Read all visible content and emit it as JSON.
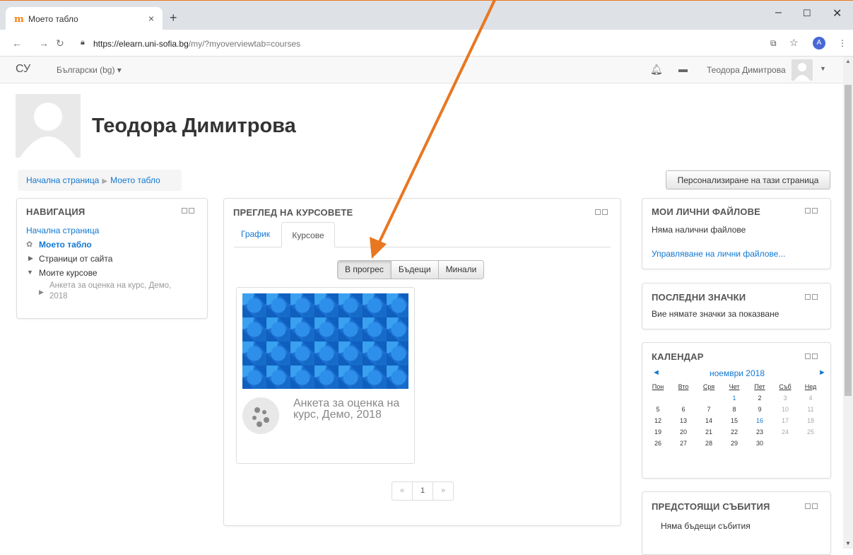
{
  "browser": {
    "tab_title": "Моето табло",
    "tab_close": "×",
    "new_tab": "+",
    "url_host": "https://elearn.uni-sofia.bg",
    "url_path": "/my/?myoverviewtab=courses",
    "profile_letter": "A",
    "win_min": "–",
    "win_max": "☐",
    "win_close": "✕"
  },
  "navbar": {
    "brand": "СУ",
    "language": "Български (bg) ▾",
    "user_name": "Теодора Димитрова"
  },
  "header": {
    "title": "Теодора Димитрова",
    "breadcrumb": [
      "Начална страница",
      "Моето табло"
    ],
    "customize_button": "Персонализиране на тази страница"
  },
  "navigation_block": {
    "title": "НАВИГАЦИЯ",
    "home": "Начална страница",
    "dashboard": "Моето табло",
    "site_pages": "Страници от сайта",
    "my_courses": "Моите курсове",
    "course_line1": "Анкета за оценка на курс, Демо,",
    "course_line2": "2018"
  },
  "course_overview": {
    "title": "ПРЕГЛЕД НА КУРСОВЕТЕ",
    "tabs": [
      "График",
      "Курсове"
    ],
    "filters": [
      "В прогрес",
      "Бъдещи",
      "Минали"
    ],
    "course_name": "Анкета за оценка на курс, Демо, 2018",
    "pager": [
      "«",
      "1",
      "»"
    ]
  },
  "private_files": {
    "title": "МОИ ЛИЧНИ ФАЙЛОВЕ",
    "empty": "Няма налични файлове",
    "manage": "Управляване на лични файлове..."
  },
  "badges": {
    "title": "ПОСЛЕДНИ ЗНАЧКИ",
    "empty": "Вие нямате значки за показване"
  },
  "calendar": {
    "title": "КАЛЕНДАР",
    "prev": "◄",
    "month": "ноември 2018",
    "next": "►",
    "weekdays": [
      "Пон",
      "Вто",
      "Сря",
      "Чет",
      "Пет",
      "Съб",
      "Нед"
    ],
    "weeks": [
      [
        "",
        "",
        "",
        "1",
        "2",
        "3",
        "4"
      ],
      [
        "5",
        "6",
        "7",
        "8",
        "9",
        "10",
        "11"
      ],
      [
        "12",
        "13",
        "14",
        "15",
        "16",
        "17",
        "18"
      ],
      [
        "19",
        "20",
        "21",
        "22",
        "23",
        "24",
        "25"
      ],
      [
        "26",
        "27",
        "28",
        "29",
        "30",
        "",
        ""
      ]
    ]
  },
  "upcoming": {
    "title": "ПРЕДСТОЯЩИ СЪБИТИЯ",
    "empty": "Няма бъдещи събития"
  },
  "colors": {
    "annotation_arrow": "#e87722",
    "link": "#1177d1"
  }
}
